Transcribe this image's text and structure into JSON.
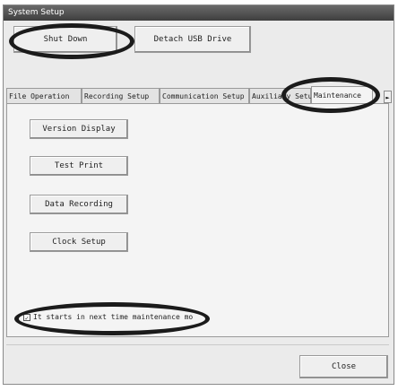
{
  "window": {
    "title": "System Setup"
  },
  "toolbar": {
    "shutdown_label": "Shut Down",
    "detach_label": "Detach USB Drive"
  },
  "tabs": [
    {
      "label": "File Operation"
    },
    {
      "label": "Recording Setup"
    },
    {
      "label": "Communication Setup"
    },
    {
      "label": "Auxiliary Setup"
    },
    {
      "label": "Maintenance"
    }
  ],
  "tab_scroll": {
    "glyph": "►"
  },
  "maintenance": {
    "buttons": [
      {
        "label": "Version Display"
      },
      {
        "label": "Test Print"
      },
      {
        "label": "Data Recording"
      },
      {
        "label": "Clock Setup"
      }
    ],
    "checkbox": {
      "checked": true,
      "mark": "✓",
      "label": "It starts in next time maintenance mo"
    }
  },
  "footer": {
    "close_label": "Close"
  }
}
